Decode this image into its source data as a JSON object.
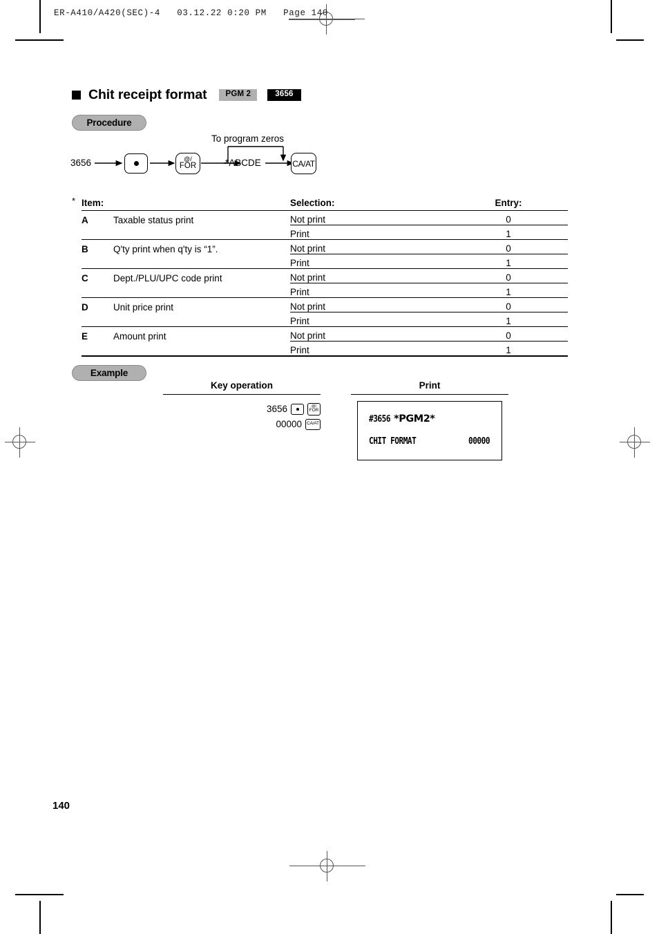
{
  "running_header": "ER-A410/A420(SEC)-4   03.12.22 0:20 PM   Page 140",
  "section": {
    "title": "Chit receipt format",
    "badge_mode": "PGM 2",
    "badge_code": "3656"
  },
  "labels": {
    "procedure": "Procedure",
    "example": "Example"
  },
  "procedure_flow": {
    "start_code": "3656",
    "key_point": "●",
    "key_at": "@/",
    "key_for": "FOR",
    "operand": "*ABCDE",
    "key_caat": "CA/AT",
    "loop_note": "To program zeros"
  },
  "table": {
    "star": "*",
    "headers": {
      "item": "Item:",
      "selection": "Selection:",
      "entry": "Entry:"
    },
    "rows": [
      {
        "letter": "A",
        "item": "Taxable status print",
        "options": [
          {
            "selection": "Not print",
            "entry": "0"
          },
          {
            "selection": "Print",
            "entry": "1"
          }
        ]
      },
      {
        "letter": "B",
        "item": "Q'ty print when q'ty is “1”.",
        "options": [
          {
            "selection": "Not print",
            "entry": "0"
          },
          {
            "selection": "Print",
            "entry": "1"
          }
        ]
      },
      {
        "letter": "C",
        "item": "Dept./PLU/UPC code print",
        "options": [
          {
            "selection": "Not print",
            "entry": "0"
          },
          {
            "selection": "Print",
            "entry": "1"
          }
        ]
      },
      {
        "letter": "D",
        "item": "Unit price print",
        "options": [
          {
            "selection": "Not print",
            "entry": "0"
          },
          {
            "selection": "Print",
            "entry": "1"
          }
        ]
      },
      {
        "letter": "E",
        "item": "Amount print",
        "options": [
          {
            "selection": "Not print",
            "entry": "0"
          },
          {
            "selection": "Print",
            "entry": "1"
          }
        ]
      }
    ]
  },
  "example": {
    "key_operation_header": "Key operation",
    "print_header": "Print",
    "key_operation": {
      "line1_value": "3656",
      "line1_key_dot": "●",
      "line1_key_at": "@/",
      "line1_key_for": "FOR",
      "line2_value": "00000",
      "line2_key_caat": "CA/AT"
    },
    "print_receipt": {
      "line1_code": "#3656 ",
      "line1_star_left": "*",
      "line1_mode": "PGM2",
      "line1_star_right": "*",
      "line2_label": "CHIT FORMAT",
      "line2_value": "00000"
    }
  },
  "page_number": "140"
}
